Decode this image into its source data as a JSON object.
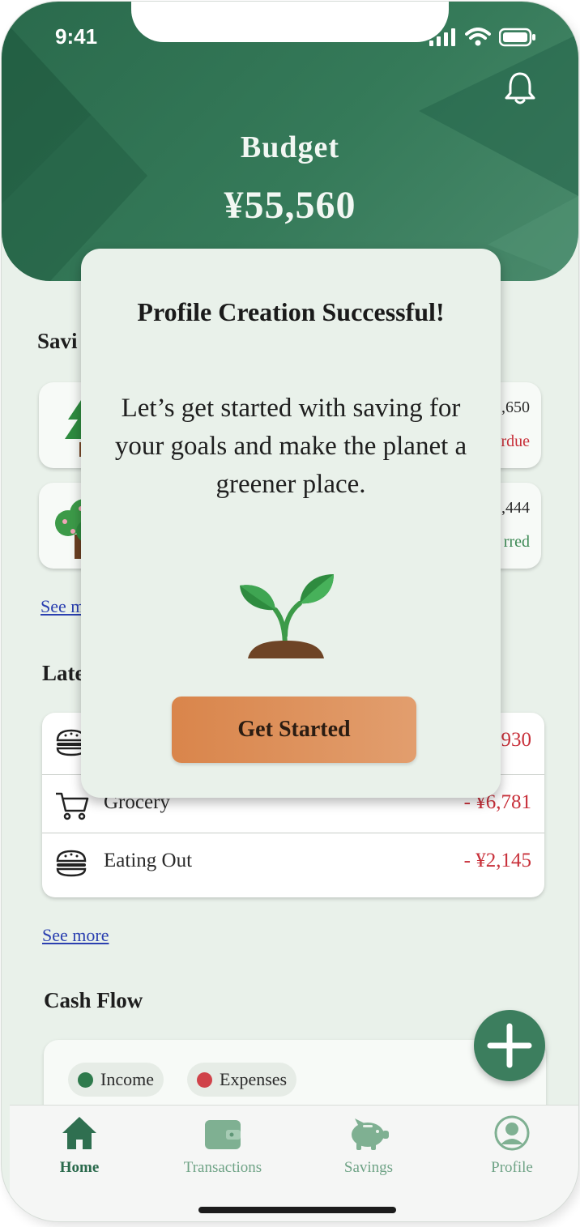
{
  "status_bar": {
    "time": "9:41"
  },
  "header": {
    "title": "Budget",
    "amount": "¥55,560"
  },
  "savings": {
    "title_visible": "Savi",
    "see_more": "See m",
    "goals": [
      {
        "icon": "pine-tree-icon",
        "amount_visible": ",650",
        "status_visible": "rdue",
        "status_color": "#c8303a"
      },
      {
        "icon": "flowering-tree-icon",
        "amount_visible": ",444",
        "status_visible": "rred",
        "status_color": "#3d8a55"
      }
    ]
  },
  "latest": {
    "title_visible": "Late",
    "rows": [
      {
        "icon": "burger-icon",
        "label": "",
        "amount_visible": "930"
      },
      {
        "icon": "cart-icon",
        "label": "Grocery",
        "amount": "- ¥6,781"
      },
      {
        "icon": "burger-icon",
        "label": "Eating Out",
        "amount": "- ¥2,145"
      }
    ],
    "see_more": "See more"
  },
  "cash_flow": {
    "title": "Cash Flow",
    "legend": [
      {
        "label": "Income",
        "color": "#2e7a4c"
      },
      {
        "label": "Expenses",
        "color": "#d0434a"
      }
    ]
  },
  "tabbar": {
    "items": [
      {
        "label": "Home",
        "icon": "home-icon",
        "active": true
      },
      {
        "label": "Transactions",
        "icon": "wallet-icon",
        "active": false
      },
      {
        "label": "Savings",
        "icon": "piggy-bank-icon",
        "active": false
      },
      {
        "label": "Profile",
        "icon": "profile-icon",
        "active": false
      }
    ]
  },
  "modal": {
    "title": "Profile Creation Successful!",
    "body": "Let’s get started with saving for your goals and make the planet a greener place.",
    "image_icon": "sprout-icon",
    "button_label": "Get Started"
  },
  "colors": {
    "brand_green": "#2f6f50",
    "background": "#e9f1ea",
    "expense_red": "#c8303a",
    "button_orange": "#dc8c55"
  }
}
